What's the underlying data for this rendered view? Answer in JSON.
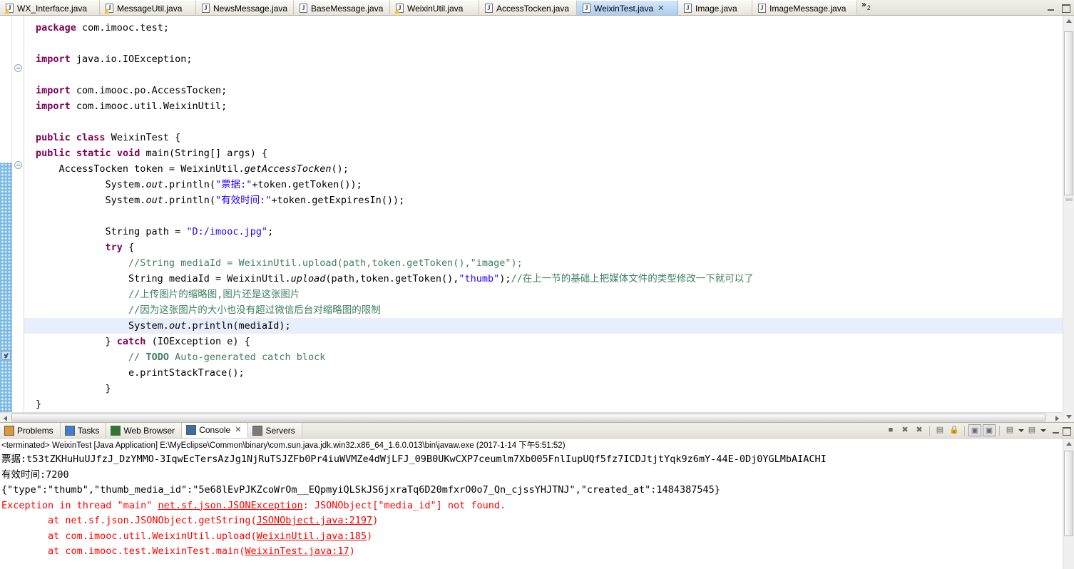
{
  "editor_tabs": [
    {
      "label": "WX_Interface.java",
      "icon": "java-file-warning-icon",
      "active": false,
      "width": 140
    },
    {
      "label": "MessageUtil.java",
      "icon": "java-file-warning-icon",
      "active": false,
      "width": 135
    },
    {
      "label": "NewsMessage.java",
      "icon": "java-file-icon",
      "active": false,
      "width": 137
    },
    {
      "label": "BaseMessage.java",
      "icon": "java-file-icon",
      "active": false,
      "width": 135
    },
    {
      "label": "WeixinUtil.java",
      "icon": "java-file-warning-icon",
      "active": false,
      "width": 125
    },
    {
      "label": "AccessTocken.java",
      "icon": "java-file-icon",
      "active": false,
      "width": 137
    },
    {
      "label": "WeixinTest.java",
      "icon": "java-file-icon",
      "active": true,
      "width": 142
    },
    {
      "label": "Image.java",
      "icon": "java-file-icon",
      "active": false,
      "width": 104
    },
    {
      "label": "ImageMessage.java",
      "icon": "java-file-icon",
      "active": false,
      "width": 147
    }
  ],
  "tab_close_glyph": "✕",
  "tab_overflow": {
    "chevron": "»",
    "count": "2"
  },
  "window_buttons": {
    "minimize": "minimize-icon",
    "maximize": "maximize-icon"
  },
  "code": {
    "filename": "WeixinTest.java",
    "highlight_line": 17,
    "lines": [
      "package com.imooc.test;",
      "",
      "import java.io.IOException;",
      "",
      "import com.imooc.po.AccessTocken;",
      "import com.imooc.util.WeixinUtil;",
      "",
      "public class WeixinTest {",
      "public static void main(String[] args) {",
      "    AccessTocken token = WeixinUtil.getAccessTocken();",
      "            System.out.println(\"票据:\"+token.getToken());",
      "            System.out.println(\"有效时间:\"+token.getExpiresIn());",
      "",
      "            String path = \"D:/imooc.jpg\";",
      "            try {",
      "                //String mediaId = WeixinUtil.upload(path,token.getToken(),\"image\");",
      "                String mediaId = WeixinUtil.upload(path,token.getToken(),\"thumb\");//在上一节的基础上把媒体文件的类型修改一下就可以了",
      "                //上传图片的缩略图,图片还是这张图片",
      "                //因为这张图片的大小也没有超过微信后台对缩略图的限制",
      "                System.out.println(mediaId);",
      "            } catch (IOException e) {",
      "                // TODO Auto-generated catch block",
      "                e.printStackTrace();",
      "            }",
      "}"
    ],
    "colors": {
      "keyword": "#7F0055",
      "string": "#2A00FF",
      "comment": "#3F7F5F",
      "plain": "#000000",
      "highlight_row": "#E8EEFB"
    }
  },
  "view_tabs": [
    {
      "label": "Problems",
      "icon": "problems-icon",
      "active": false
    },
    {
      "label": "Tasks",
      "icon": "tasks-icon",
      "active": false
    },
    {
      "label": "Web Browser",
      "icon": "web-browser-icon",
      "active": false
    },
    {
      "label": "Console",
      "icon": "console-icon",
      "active": true
    },
    {
      "label": "Servers",
      "icon": "servers-icon",
      "active": false
    }
  ],
  "console_toolbar": [
    {
      "name": "terminate-button",
      "glyph": "■"
    },
    {
      "name": "remove-launch-button",
      "glyph": "✖"
    },
    {
      "name": "remove-all-terminated-button",
      "glyph": "✖"
    },
    {
      "name": "clear-console-button",
      "glyph": "▤"
    },
    {
      "name": "scroll-lock-button",
      "glyph": "🔒"
    },
    {
      "name": "pin-console-button",
      "glyph": "▣"
    },
    {
      "name": "display-selected-console-button",
      "glyph": "▣"
    },
    {
      "name": "open-console-button",
      "glyph": "▤"
    },
    {
      "name": "new-console-view-button",
      "glyph": "▤"
    }
  ],
  "console": {
    "terminated_line": "<terminated> WeixinTest [Java Application] E:\\MyEclipse\\Common\\binary\\com.sun.java.jdk.win32.x86_64_1.6.0.013\\bin\\javaw.exe (2017-1-14 下午5:51:52)",
    "lines": [
      {
        "text": "票据:t53tZKHuHuUJfzJ_DzYMMO-3IqwEcTersAzJg1NjRuTSJZFb0Pr4iuWVMZe4dWjLFJ_09B0UKwCXP7ceumlm7Xb005FnlIupUQf5fz7ICDJtjtYqk9z6mY-44E-0Dj0YGLMbAIACHI",
        "style": "plain"
      },
      {
        "text": "有效时间:7200",
        "style": "plain"
      },
      {
        "text": "{\"type\":\"thumb\",\"thumb_media_id\":\"5e68lEvPJKZcoWrOm__EQpmyiQLSkJS6jxraTq6D20mfxrO0o7_Qn_cjssYHJTNJ\",\"created_at\":1484387545}",
        "style": "plain"
      }
    ],
    "error_lines": [
      {
        "prefix": "Exception in thread \"main\" ",
        "link": "net.sf.json.JSONException",
        "suffix": ": JSONObject[\"media_id\"] not found."
      },
      {
        "prefix": "        at net.sf.json.JSONObject.getString(",
        "link": "JSONObject.java:2197",
        "suffix": ")"
      },
      {
        "prefix": "        at com.imooc.util.WeixinUtil.upload(",
        "link": "WeixinUtil.java:185",
        "suffix": ")"
      },
      {
        "prefix": "        at com.imooc.test.WeixinTest.main(",
        "link": "WeixinTest.java:17",
        "suffix": ")"
      }
    ],
    "error_color": "#FF0000"
  }
}
